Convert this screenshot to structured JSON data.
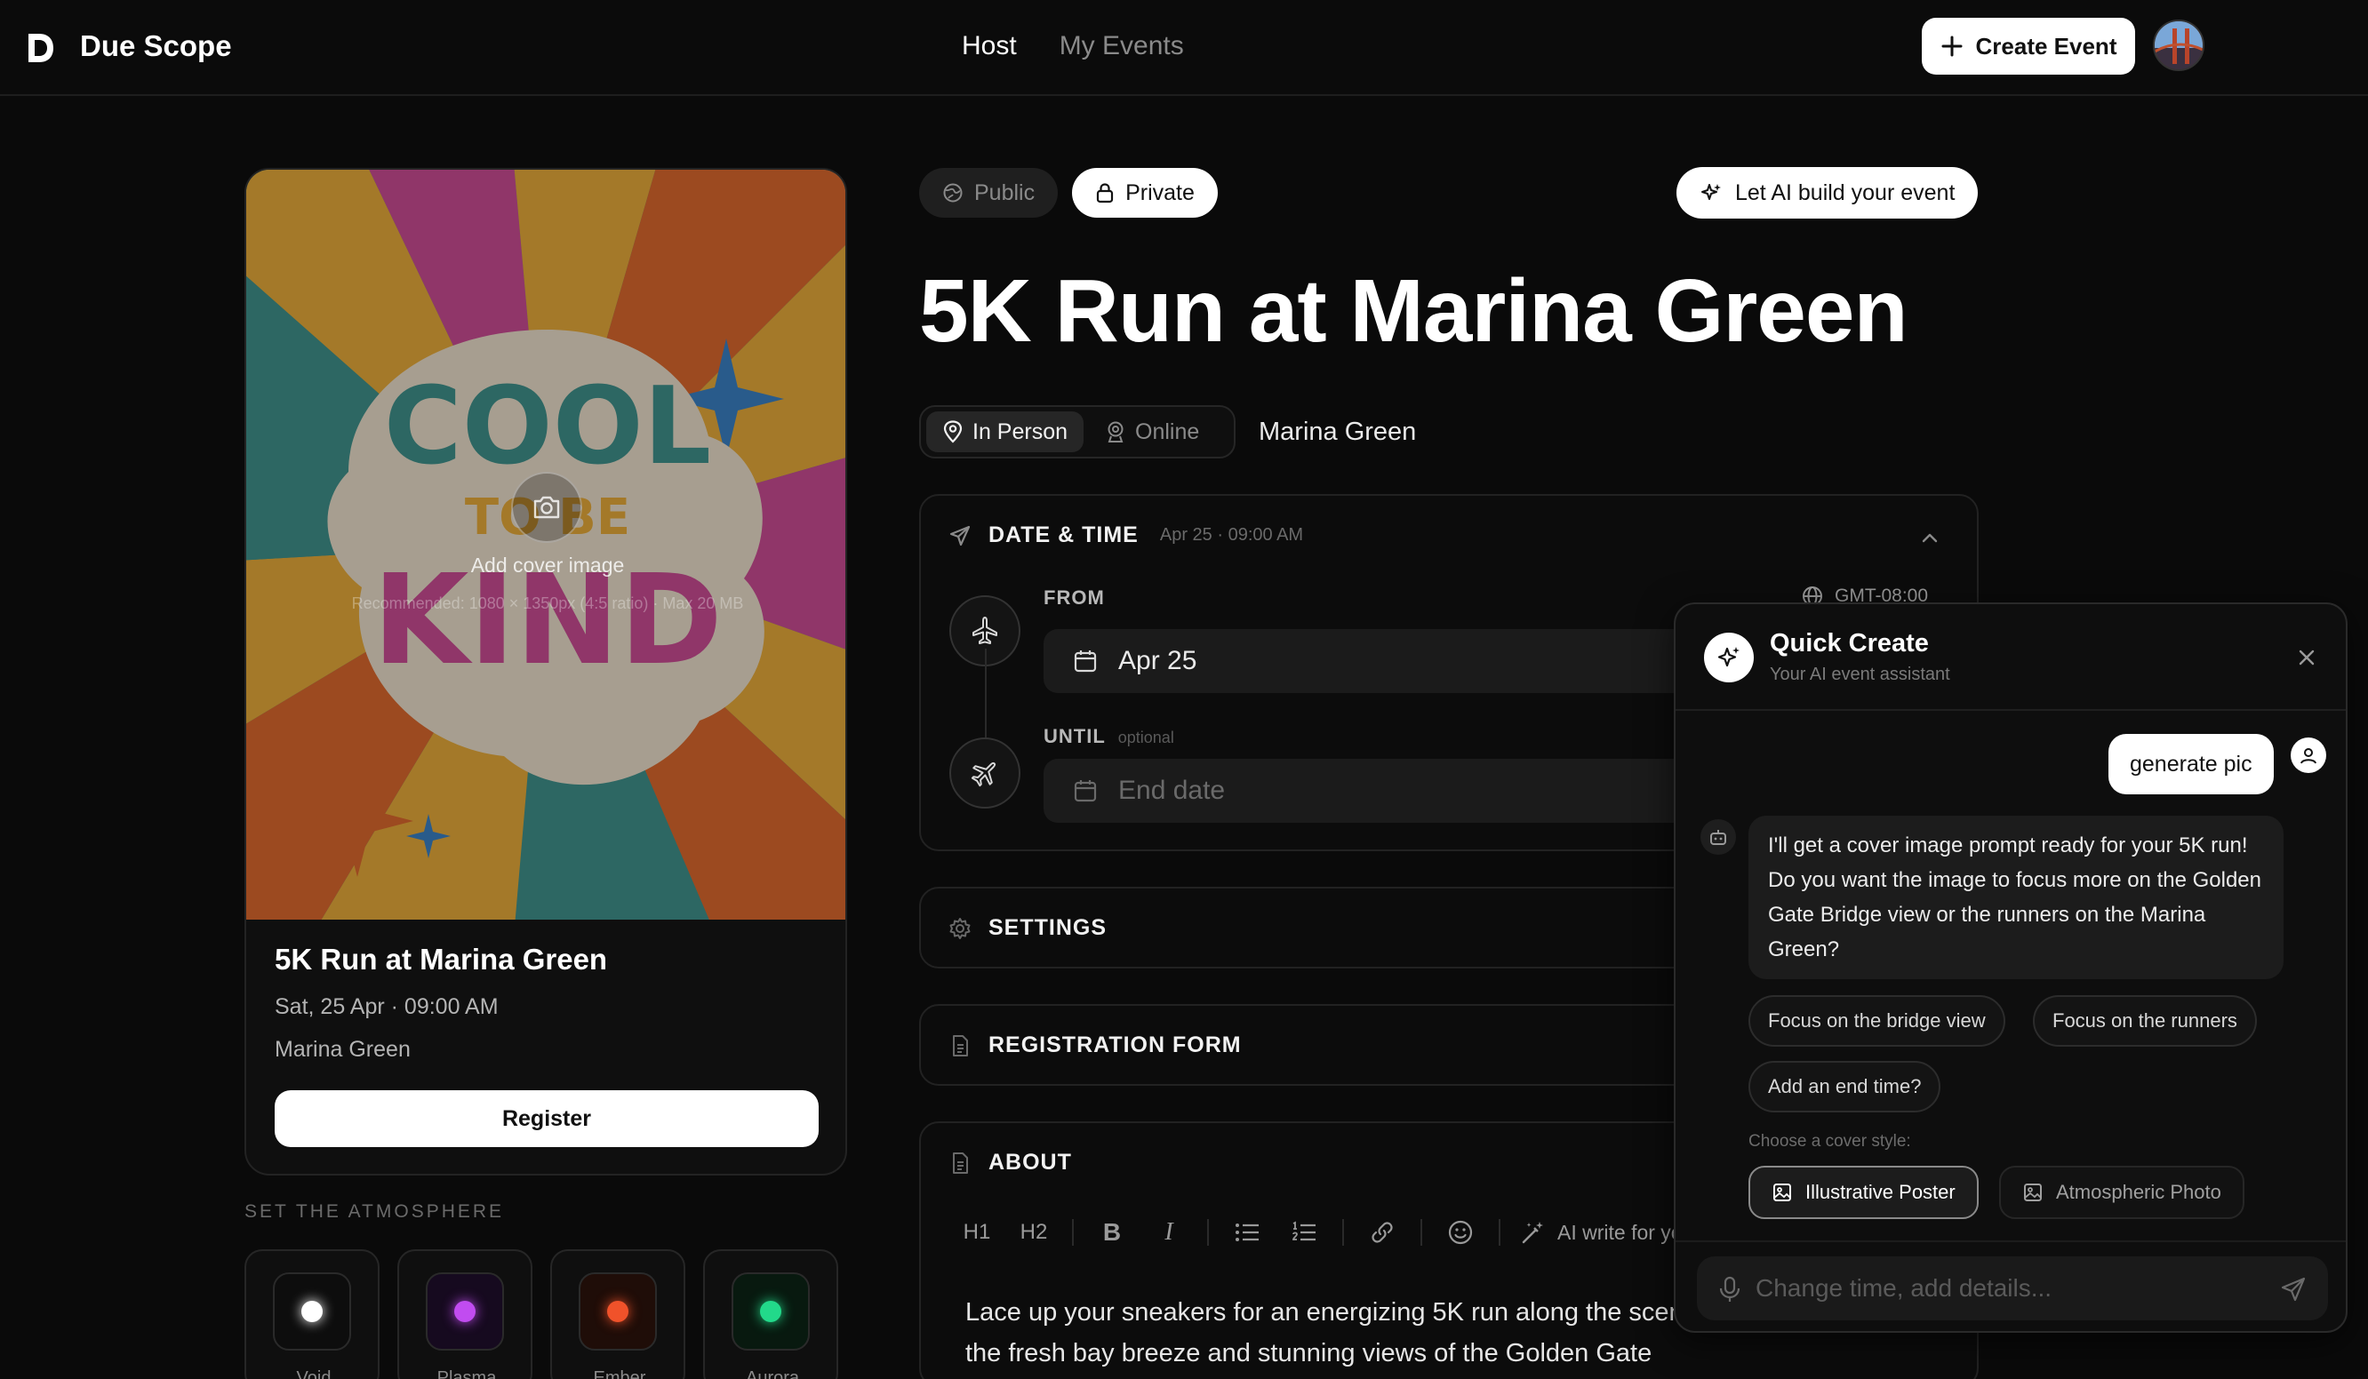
{
  "app": {
    "brand": "Due Scope",
    "logo_letter": "D"
  },
  "nav": {
    "items": [
      {
        "label": "Host",
        "active": true
      },
      {
        "label": "My Events",
        "active": false
      }
    ]
  },
  "header": {
    "create_label": "Create Event"
  },
  "preview": {
    "add_cover": "Add cover image",
    "recommended": "Recommended: 1080 × 1350px (4:5 ratio) · Max 20 MB",
    "cover_art_text": [
      "COOL",
      "TO BE",
      "KIND"
    ],
    "title": "5K Run at Marina Green",
    "date": "Sat, 25 Apr · 09:00 AM",
    "location": "Marina Green",
    "register_label": "Register"
  },
  "atmosphere": {
    "label": "SET THE ATMOSPHERE",
    "options": [
      {
        "name": "Void",
        "color": "#ffffff",
        "bg": "#0d0d0d"
      },
      {
        "name": "Plasma",
        "color": "#c14cf0",
        "bg": "#160a1f"
      },
      {
        "name": "Ember",
        "color": "#f0522a",
        "bg": "#1f0d08"
      },
      {
        "name": "Aurora",
        "color": "#22d98a",
        "bg": "#08190f"
      }
    ]
  },
  "visibility": {
    "public_label": "Public",
    "private_label": "Private",
    "selected": "Private"
  },
  "ai_build_label": "Let AI build your event",
  "event": {
    "title": "5K Run at Marina Green"
  },
  "location_mode": {
    "in_person_label": "In Person",
    "online_label": "Online",
    "selected": "In Person",
    "value": "Marina Green"
  },
  "datetime": {
    "title": "DATE & TIME",
    "summary": "Apr 25 · 09:00 AM",
    "timezone": "GMT-08:00",
    "from_label": "FROM",
    "from_value": "Apr 25",
    "until_label": "UNTIL",
    "until_optional": "optional",
    "until_placeholder": "End date"
  },
  "sections": {
    "settings": "SETTINGS",
    "registration": "REGISTRATION FORM",
    "about": "ABOUT"
  },
  "about": {
    "toolbar": {
      "h1": "H1",
      "h2": "H2",
      "bold": "B",
      "italic": "I",
      "ai_write": "AI write for you"
    },
    "text": "Lace up your sneakers for an energizing 5K run along the scenic waterfront! Enjoy the fresh bay breeze and stunning views of the Golden Gate"
  },
  "quick_create": {
    "title": "Quick Create",
    "subtitle": "Your AI event assistant",
    "user_message": "generate pic",
    "bot_message": "I'll get a cover image prompt ready for your 5K run! Do you want the image to focus more on the Golden Gate Bridge view or the runners on the Marina Green?",
    "chips": [
      "Focus on the bridge view",
      "Focus on the runners",
      "Add an end time?"
    ],
    "style_label": "Choose a cover style:",
    "styles": [
      "Illustrative Poster",
      "Atmospheric Photo"
    ],
    "selected_style": "Illustrative Poster",
    "input_placeholder": "Change time, add details..."
  }
}
